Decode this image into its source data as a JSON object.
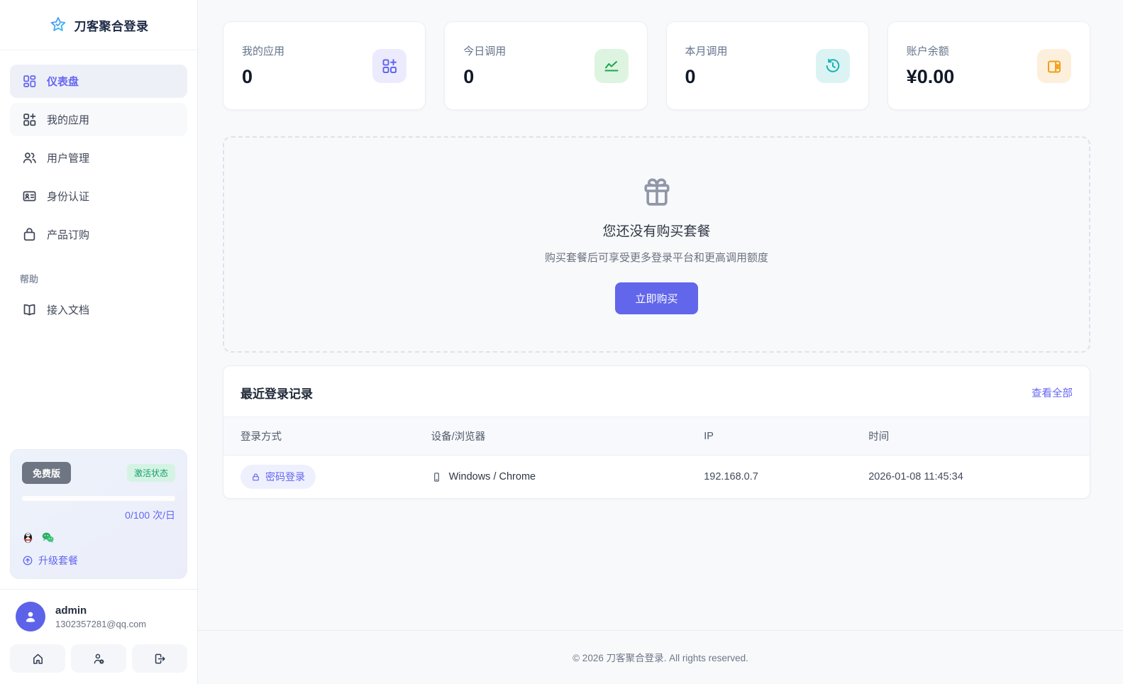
{
  "app": {
    "name": "刀客聚合登录"
  },
  "sidebar": {
    "menu": [
      {
        "label": "仪表盘",
        "icon": "dashboard-grid-icon",
        "active": true
      },
      {
        "label": "我的应用",
        "icon": "apps-plus-icon",
        "active": false
      },
      {
        "label": "用户管理",
        "icon": "users-icon",
        "active": false
      },
      {
        "label": "身份认证",
        "icon": "id-card-icon",
        "active": false
      },
      {
        "label": "产品订购",
        "icon": "shopping-bag-icon",
        "active": false
      }
    ],
    "help_label": "帮助",
    "docs_label": "接入文档",
    "plan": {
      "name": "免费版",
      "status": "激活状态",
      "quota": "0/100 次/日",
      "progress_percent": 0,
      "platform_icons": [
        "qq-icon",
        "wechat-icon"
      ],
      "upgrade_label": "升级套餐"
    },
    "user": {
      "name": "admin",
      "email": "1302357281@qq.com"
    },
    "actions": [
      "home-icon",
      "user-gear-icon",
      "logout-icon"
    ]
  },
  "colors": {
    "accent": "#6366f1",
    "green": "#1da64e",
    "teal": "#16b3b3",
    "orange": "#f29d12",
    "status_active": "#15a06a"
  },
  "stats": [
    {
      "label": "我的应用",
      "value": "0",
      "icon": "apps-plus-icon"
    },
    {
      "label": "今日调用",
      "value": "0",
      "icon": "line-chart-icon"
    },
    {
      "label": "本月调用",
      "value": "0",
      "icon": "clock-history-icon"
    },
    {
      "label": "账户余额",
      "value": "¥0.00",
      "icon": "wallet-icon"
    }
  ],
  "empty_state": {
    "icon": "gift-icon",
    "title": "您还没有购买套餐",
    "subtitle": "购买套餐后可享受更多登录平台和更高调用额度",
    "button": "立即购买"
  },
  "recent_logins": {
    "title": "最近登录记录",
    "view_all": "查看全部",
    "columns": [
      "登录方式",
      "设备/浏览器",
      "IP",
      "时间"
    ],
    "rows": [
      {
        "method": "密码登录",
        "device": "Windows / Chrome",
        "ip": "192.168.0.7",
        "time": "2026-01-08 11:45:34"
      }
    ]
  },
  "footer": {
    "copyright": "© 2026 刀客聚合登录. All rights reserved."
  }
}
